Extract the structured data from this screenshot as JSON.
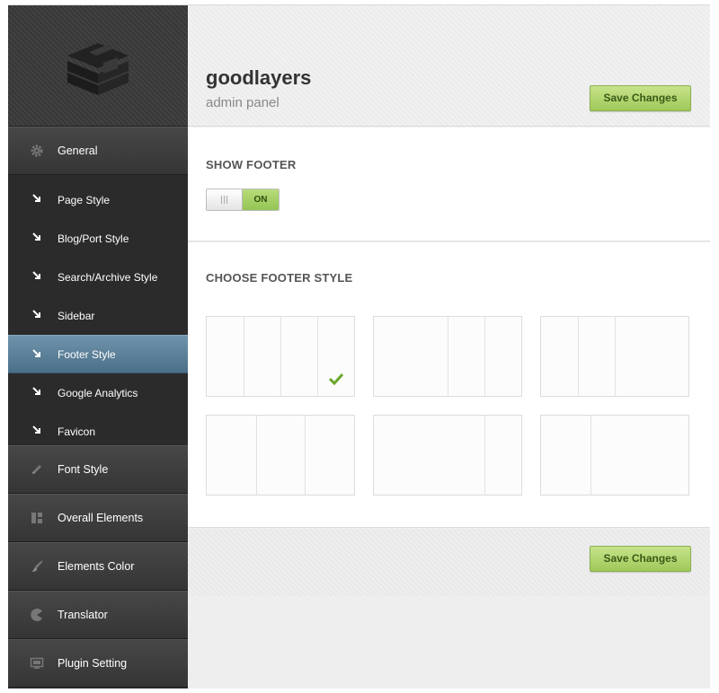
{
  "brand": {
    "title": "goodlayers",
    "subtitle": "admin panel"
  },
  "actions": {
    "save_label": "Save Changes"
  },
  "sidebar": {
    "top_items": [
      {
        "label": "General",
        "icon": "gear-icon"
      }
    ],
    "sub_items": [
      {
        "label": "Page Style",
        "icon": "arrow-down-right-icon",
        "active": false
      },
      {
        "label": "Blog/Port Style",
        "icon": "arrow-down-right-icon",
        "active": false
      },
      {
        "label": "Search/Archive Style",
        "icon": "arrow-down-right-icon",
        "active": false
      },
      {
        "label": "Sidebar",
        "icon": "arrow-down-right-icon",
        "active": false
      },
      {
        "label": "Footer Style",
        "icon": "arrow-down-right-icon",
        "active": true
      },
      {
        "label": "Google Analytics",
        "icon": "arrow-down-right-icon",
        "active": false
      },
      {
        "label": "Favicon",
        "icon": "arrow-down-right-icon",
        "active": false
      }
    ],
    "bottom_items": [
      {
        "label": "Font Style",
        "icon": "pencil-icon"
      },
      {
        "label": "Overall Elements",
        "icon": "layout-icon"
      },
      {
        "label": "Elements Color",
        "icon": "brush-icon"
      },
      {
        "label": "Translator",
        "icon": "pacman-icon"
      },
      {
        "label": "Plugin Setting",
        "icon": "screen-icon"
      }
    ]
  },
  "show_footer": {
    "heading": "SHOW FOOTER",
    "toggle_label": "ON",
    "enabled": true
  },
  "footer_style": {
    "heading": "CHOOSE FOOTER STYLE",
    "options": [
      {
        "columns": [
          1,
          1,
          1,
          1
        ],
        "selected": true
      },
      {
        "columns": [
          2,
          1,
          1
        ],
        "selected": false
      },
      {
        "columns": [
          1,
          1,
          2
        ],
        "selected": false
      },
      {
        "columns": [
          1,
          1,
          1
        ],
        "selected": false
      },
      {
        "columns": [
          3,
          1
        ],
        "selected": false
      },
      {
        "columns": [
          1,
          2
        ],
        "selected": false
      }
    ]
  },
  "colors": {
    "active_nav": "#5a7f98",
    "save_button": "#b3d673",
    "toggle_on": "#a6d064"
  }
}
